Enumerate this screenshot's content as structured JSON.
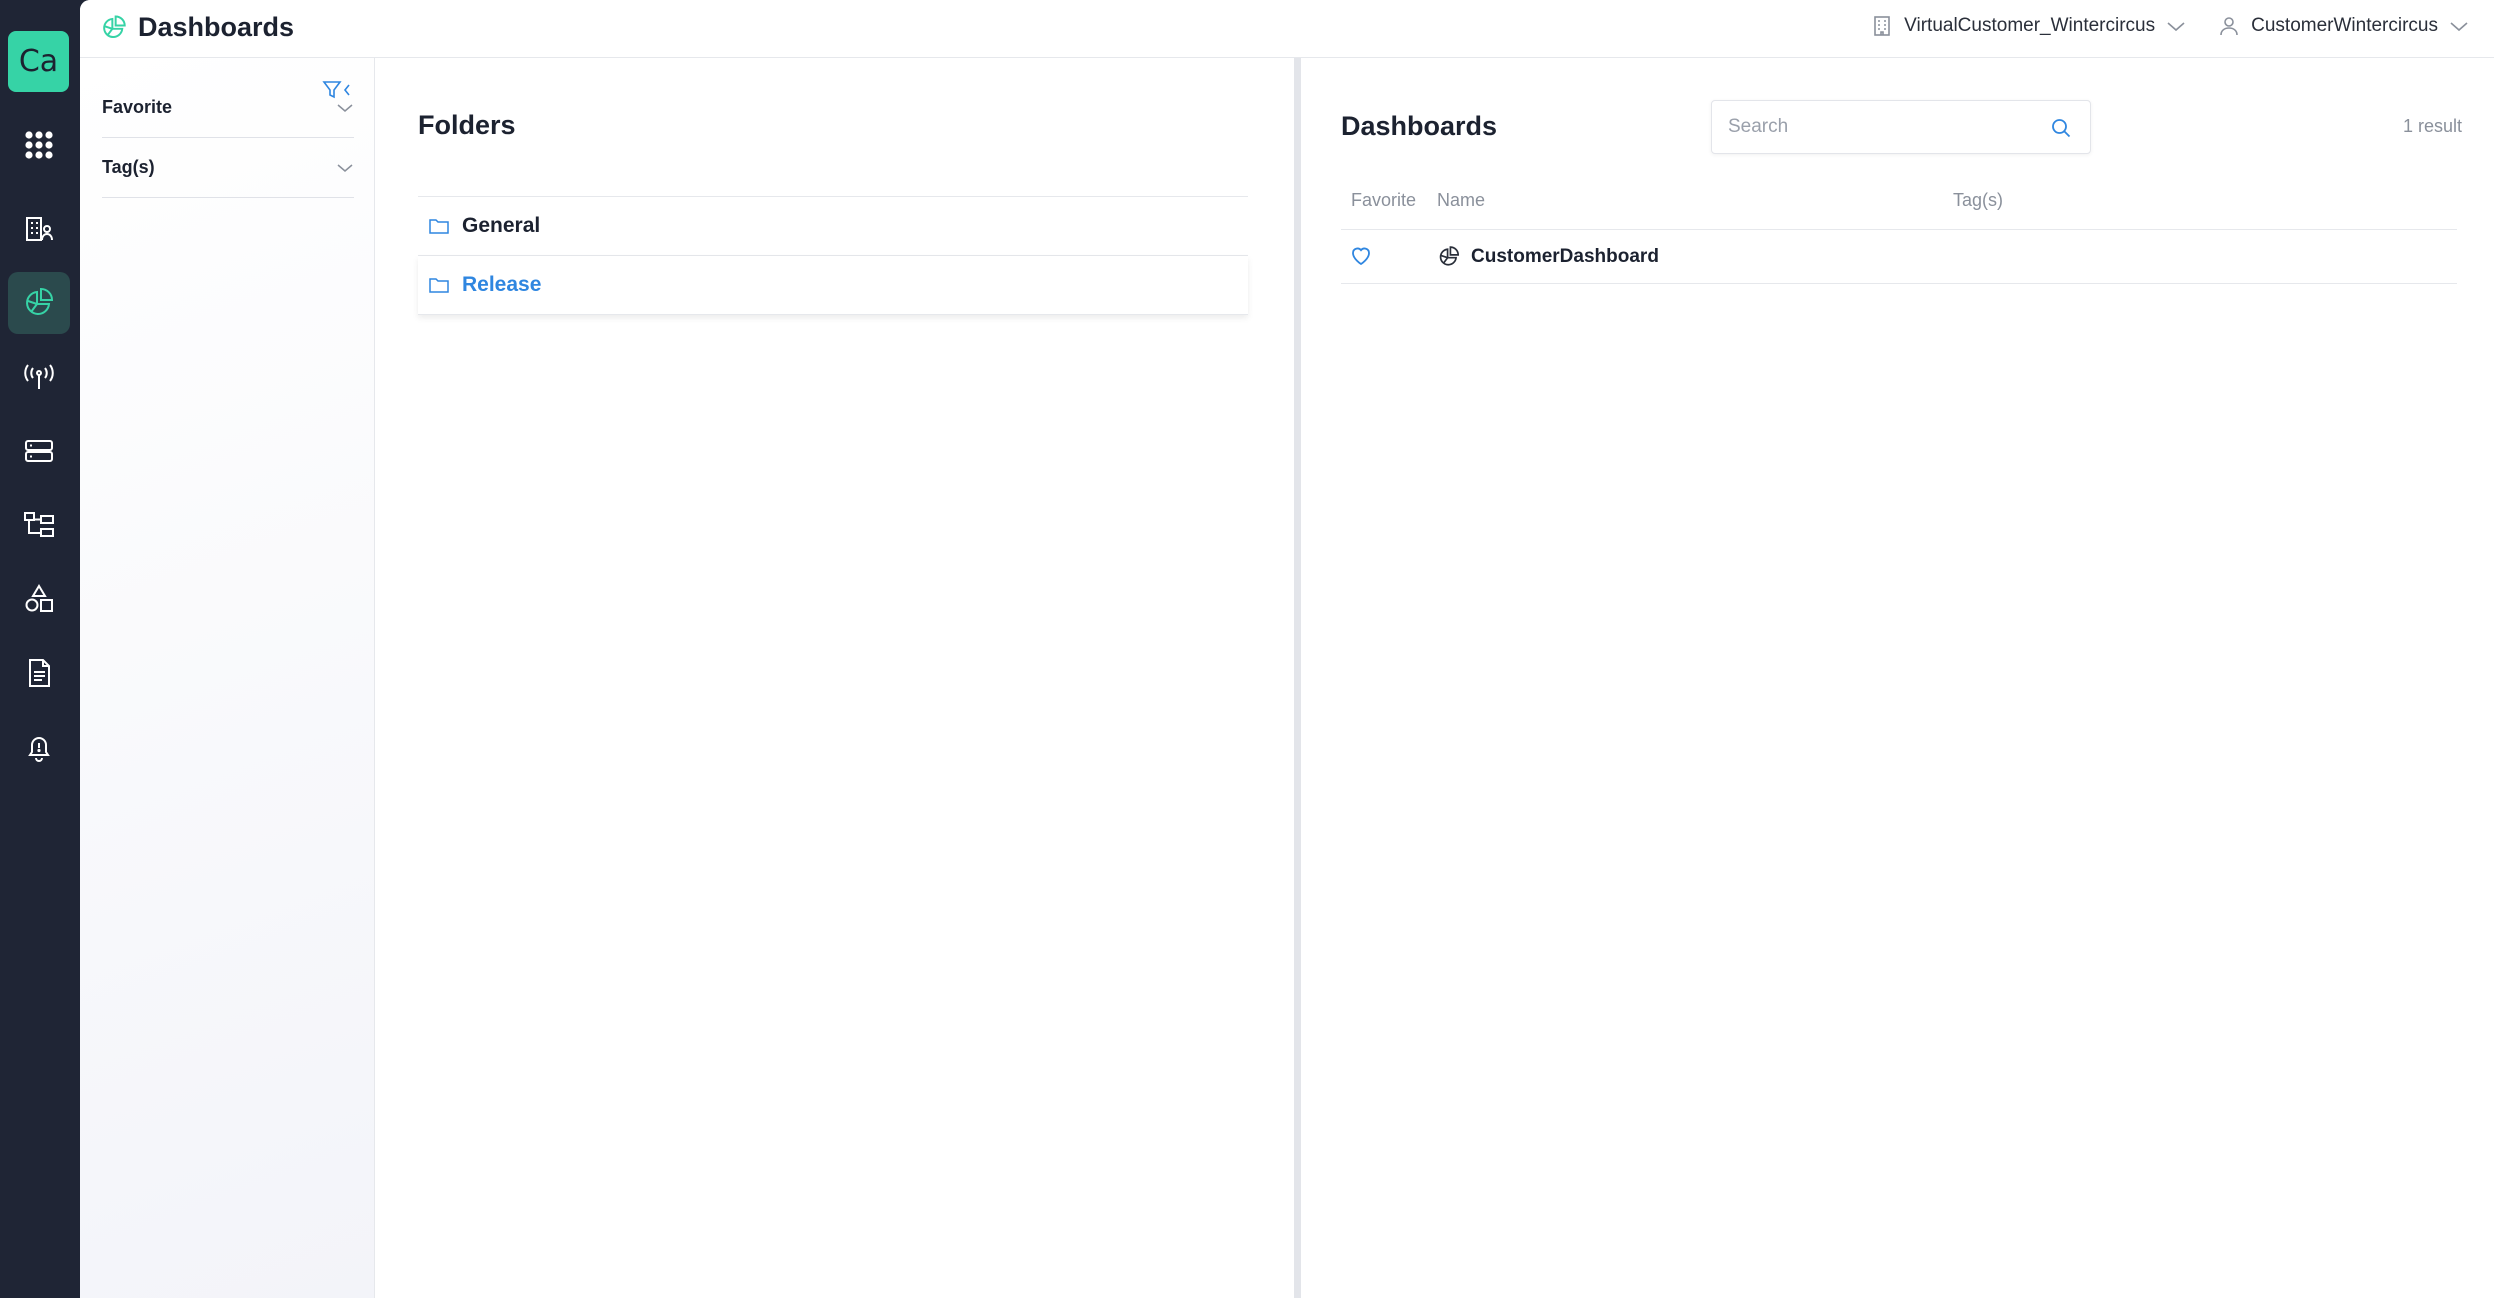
{
  "rail": {
    "logo_text": "Ca",
    "items": [
      {
        "icon": "apps-grid-icon"
      },
      {
        "icon": "buildings-icon"
      },
      {
        "icon": "dashboard-pie-icon",
        "active": true
      },
      {
        "icon": "antenna-icon"
      },
      {
        "icon": "server-icon"
      },
      {
        "icon": "hierarchy-icon"
      },
      {
        "icon": "shapes-icon"
      },
      {
        "icon": "document-icon"
      },
      {
        "icon": "bell-icon"
      }
    ]
  },
  "header": {
    "title": "Dashboards",
    "customer_selector": "VirtualCustomer_Wintercircus",
    "user_selector": "CustomerWintercircus"
  },
  "filters": {
    "favorite_label": "Favorite",
    "tags_label": "Tag(s)"
  },
  "folders": {
    "title": "Folders",
    "items": [
      {
        "label": "General",
        "selected": false
      },
      {
        "label": "Release",
        "selected": true
      }
    ]
  },
  "dashboards": {
    "title": "Dashboards",
    "search_placeholder": "Search",
    "result_count": "1 result",
    "columns": {
      "favorite": "Favorite",
      "name": "Name",
      "tags": "Tag(s)"
    },
    "rows": [
      {
        "name": "CustomerDashboard",
        "favorite": false,
        "tags": ""
      }
    ]
  },
  "colors": {
    "rail_bg": "#1f2535",
    "accent": "#36d3a6",
    "link_blue": "#2f86e0"
  }
}
